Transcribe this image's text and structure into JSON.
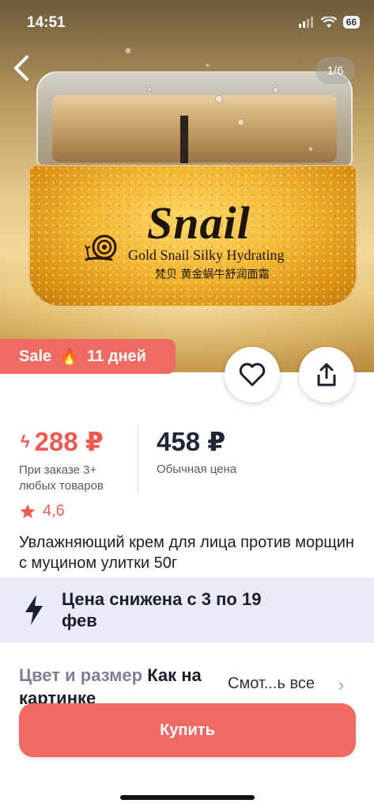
{
  "status_bar": {
    "time": "14:51",
    "battery": "66"
  },
  "gallery": {
    "pager": "1/6",
    "brand": "Snail",
    "brand_subtitle": "Gold Snail Silky Hydrating",
    "brand_cn": "梵贝 黄金蜗牛舒润面霜"
  },
  "sale_badge": {
    "label": "Sale",
    "icon": "fire-icon",
    "days": "11 дней"
  },
  "actions": {
    "favorite_icon": "heart-icon",
    "share_icon": "share-icon"
  },
  "prices": {
    "current": "288 ₽",
    "current_note": "При заказе 3+ любых товаров",
    "regular": "458 ₽",
    "regular_note": "Обычная цена"
  },
  "rating": {
    "value": "4,6",
    "icon": "star-icon"
  },
  "product_title": "Увлажняющий крем для лица против морщин с муцином улитки 50г",
  "promo": {
    "icon": "lightning-icon",
    "text": "Цена снижена с 3 по 19 фев"
  },
  "variant": {
    "label": "Цвет и размер",
    "value": "Как на картинке",
    "see_all": "Смот...ь все"
  },
  "buy_button": {
    "label": "Купить"
  },
  "colors": {
    "accent": "#ef5b52",
    "promo_bg": "#e8ecf8",
    "buy": "#ee6a62"
  }
}
